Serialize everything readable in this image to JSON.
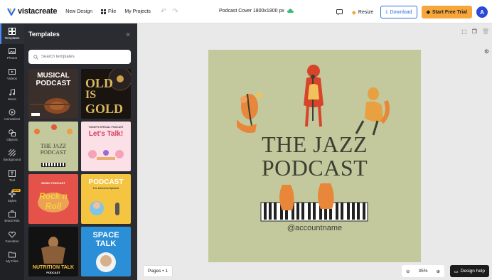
{
  "app": {
    "logo_text": "vistacreate",
    "menu": [
      {
        "label": "New Design",
        "icon": "none"
      },
      {
        "label": "File",
        "icon": "grid-icon"
      },
      {
        "label": "My Projects",
        "icon": "none"
      }
    ],
    "document_title": "Podcast Cover 1800x1800 px",
    "resize_label": "Resize",
    "download_label": "Download",
    "trial_label": "Start Free Trial",
    "avatar_initial": "A"
  },
  "rail": {
    "items": [
      {
        "label": "Templates",
        "icon": "templates-icon",
        "active": true
      },
      {
        "label": "Photos",
        "icon": "photo-icon"
      },
      {
        "label": "Videos",
        "icon": "video-icon"
      },
      {
        "label": "Music",
        "icon": "music-icon"
      },
      {
        "label": "Animations",
        "icon": "animation-icon"
      },
      {
        "label": "Objects",
        "icon": "objects-icon"
      },
      {
        "label": "Background",
        "icon": "background-icon"
      },
      {
        "label": "Text",
        "icon": "text-icon"
      },
      {
        "label": "Styles",
        "icon": "styles-icon",
        "badge": "NEW"
      },
      {
        "label": "Brand Kits",
        "icon": "brand-kit-icon"
      },
      {
        "label": "Favorites",
        "icon": "heart-icon"
      },
      {
        "label": "My Files",
        "icon": "folder-icon"
      }
    ]
  },
  "panel": {
    "title": "Templates",
    "search_placeholder": "Search templates"
  },
  "templates": [
    {
      "line1": "MUSICAL",
      "line2": "PODCAST"
    },
    {
      "line1": "OLD",
      "line2": "IS",
      "line3": "GOLD"
    },
    {
      "line1": "THE JAZZ",
      "line2": "PODCAST"
    },
    {
      "line0": "TODAY'S SPECIAL PODCAST",
      "line1": "Let's Talk!"
    },
    {
      "line0": "MUSIC PODCAST",
      "line1": "Rock n",
      "line2": "Roll"
    },
    {
      "line1": "PODCAST",
      "line2": "The Interview Episode"
    },
    {
      "line1": "NUTRITION TALK",
      "line2": "PODCAST"
    },
    {
      "line1": "SPACE",
      "line2": "TALK"
    }
  ],
  "canvas": {
    "title_line1": "THE JAZZ",
    "title_line2": "PODCAST",
    "account": "@accountname",
    "background": "#c3c99d"
  },
  "footer": {
    "pages_label": "Pages • 1",
    "zoom_value": "35%",
    "help_label": "Design help"
  },
  "colors": {
    "accent": "#2a6fd6",
    "trial": "#f7a73a",
    "rail_bg": "#1f2125",
    "panel_bg": "#2a2c31"
  }
}
